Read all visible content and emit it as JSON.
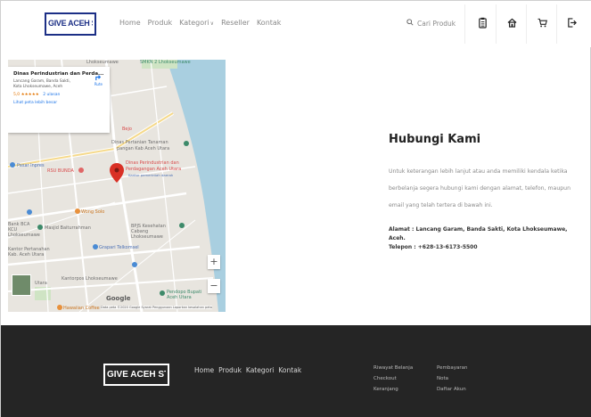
{
  "header": {
    "logo": "GIVE ACEH STORE",
    "nav": [
      {
        "label": "Home"
      },
      {
        "label": "Produk"
      },
      {
        "label": "Kategori"
      },
      {
        "label": "Reseller"
      },
      {
        "label": "Kontak"
      }
    ],
    "search_placeholder": "Cari Produk",
    "icons": [
      "clipboard-icon",
      "home-icon",
      "cart-icon",
      "login-icon"
    ]
  },
  "map": {
    "card": {
      "title": "Dinas Perindustrian dan Perda...",
      "address": "Lancang Garam, Banda Sakti, Kota Lhokseumawe, Aceh",
      "rating": "5,0",
      "stars": "★★★★★",
      "reviews": "2 ulasan",
      "link": "Lihat peta lebih besar",
      "route": "Rute"
    },
    "labels": {
      "lhokseumawe_top": "Lhokseumawe",
      "smkn2": "SMKN 2 Lhokseumawe",
      "pasar_inpres": "Pasar Inpres",
      "rsu_bunda": "RSU BUNDA",
      "dinas_pertanian": "Dinas Pertanian Tanaman",
      "dinas_pertanian_2": "pangan Kab Aceh Utara",
      "dinas_industri": "Dinas Perindustrian dan",
      "dinas_industri_2": "Perdagangan Aceh Utara",
      "dinas_industri_3": "Kantor pemerintah daerah",
      "wong_solo": "Wong Solo",
      "bca": "Bank BCA KCU Lhokseumawe",
      "masjid": "Masjid Baiturrahman",
      "bpjs": "BPJS Kesehatan Cabang Lhokseumawe",
      "dinas_pertanahan": "Kantor Pertanahan Kab. Aceh Utara",
      "grapari": "Grapari Telkomsel",
      "kantorpos": "Kantorpos Lhokseumawe",
      "pendopo": "Pendopo Bupati Aceh Utara",
      "hawaii": "Hawaiian Coffee",
      "utara": "Utara",
      "bejo": "Bejo"
    },
    "google": "Google",
    "footer_text": "Data peta ©2020 Google   Syarat Penggunaan   Laporkan kesalahan peta",
    "zoom_in": "+",
    "zoom_out": "−"
  },
  "contact": {
    "title": "Hubungi Kami",
    "description": "Untuk keterangan lebih lanjut atau anda memiliki kendala ketika berbelanja segera hubungi kami dengan alamat, telefon, maupun email yang telah tertera di bawah ini.",
    "address": "Alamat : Lancang Garam, Banda Sakti, Kota Lhokseumawe, Aceh.",
    "phone": "Telepon : +628-13-6173-5500"
  },
  "footer": {
    "logo": "GIVE ACEH STORE",
    "nav": [
      {
        "label": "Home"
      },
      {
        "label": "Produk"
      },
      {
        "label": "Kategori"
      },
      {
        "label": "Kontak"
      }
    ],
    "col1": [
      {
        "label": "Riwayat Belanja"
      },
      {
        "label": "Checkout"
      },
      {
        "label": "Keranjang"
      }
    ],
    "col2": [
      {
        "label": "Pembayaran"
      },
      {
        "label": "Nota"
      },
      {
        "label": "Daftar Akun"
      }
    ]
  },
  "colors": {
    "brand": "#1c2f86",
    "footer_bg": "#252525",
    "pin": "#d93025"
  }
}
